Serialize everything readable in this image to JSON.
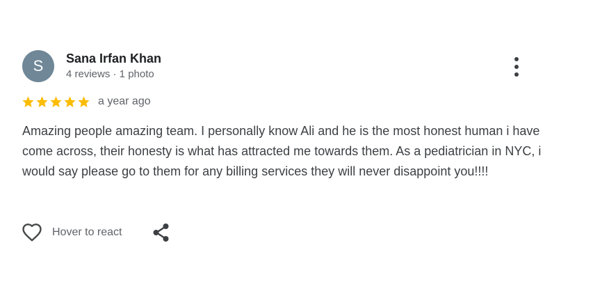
{
  "review": {
    "author": {
      "initial": "S",
      "name": "Sana Irfan Khan",
      "meta": "4 reviews · 1 photo",
      "avatar_color": "#6f8797"
    },
    "menu_icon": "more-vert-icon",
    "rating": {
      "value": 5,
      "max": 5,
      "star_color": "#fbbc04"
    },
    "time_ago": "a year ago",
    "text": "Amazing people amazing team. I personally know Ali and he is the most honest human i have come across, their honesty is what has attracted me towards them. As a pediatrician in NYC, i would say please go to them for any billing services they will never disappoint you!!!!",
    "actions": {
      "react_icon": "heart-outline-icon",
      "react_label": "Hover to react",
      "share_icon": "share-icon"
    }
  }
}
